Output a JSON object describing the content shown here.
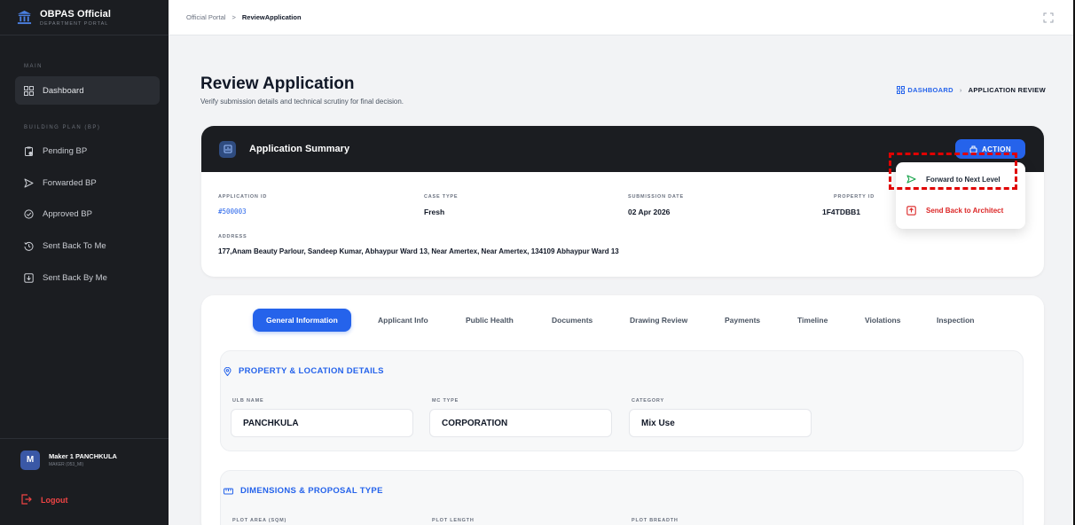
{
  "app": {
    "title": "OBPAS Official",
    "subtitle": "DEPARTMENT PORTAL"
  },
  "sidebar": {
    "section_main": "MAIN",
    "section_bp": "BUILDING PLAN (BP)",
    "items": [
      {
        "label": "Dashboard",
        "icon": "grid-icon"
      },
      {
        "label": "Pending BP",
        "icon": "clipboard-icon"
      },
      {
        "label": "Forwarded BP",
        "icon": "send-icon"
      },
      {
        "label": "Approved BP",
        "icon": "check-circle-icon"
      },
      {
        "label": "Sent Back To Me",
        "icon": "history-icon"
      },
      {
        "label": "Sent Back By Me",
        "icon": "return-box-icon"
      }
    ],
    "user": {
      "initial": "M",
      "name": "Maker 1 PANCHKULA",
      "role": "MAKER (053_MI)"
    },
    "logout": "Logout"
  },
  "topbar": {
    "crumb_root": "Official Portal",
    "crumb_sep": ">",
    "crumb_current": "ReviewApplication"
  },
  "page": {
    "title": "Review Application",
    "subtitle": "Verify submission details and technical scrutiny for final decision.",
    "crumb_dashboard": "DASHBOARD",
    "crumb_sep": "›",
    "crumb_current": "APPLICATION REVIEW"
  },
  "summary": {
    "title": "Application Summary",
    "action_label": "ACTION",
    "fields": {
      "app_id_label": "APPLICATION ID",
      "app_id_value": "#500003",
      "case_type_label": "CASE TYPE",
      "case_type_value": "Fresh",
      "submission_label": "SUBMISSION DATE",
      "submission_value": "02 Apr 2026",
      "property_label": "PROPERTY ID",
      "property_value": "1F4TDBB1",
      "address_label": "ADDRESS",
      "address_value": "177,Anam Beauty Parlour, Sandeep Kumar, Abhaypur Ward 13, Near Amertex, Near Amertex, 134109 Abhaypur Ward 13"
    }
  },
  "action_menu": {
    "forward": "Forward to Next Level",
    "send_back": "Send Back to Architect"
  },
  "tabs": [
    "General Information",
    "Applicant Info",
    "Public Health",
    "Documents",
    "Drawing Review",
    "Payments",
    "Timeline",
    "Violations",
    "Inspection"
  ],
  "property_section": {
    "title": "PROPERTY & LOCATION DETAILS",
    "ulb_label": "ULB NAME",
    "ulb_value": "PANCHKULA",
    "mc_label": "MC TYPE",
    "mc_value": "CORPORATION",
    "category_label": "CATEGORY",
    "category_value": "Mix Use"
  },
  "dimensions_section": {
    "title": "DIMENSIONS & PROPOSAL TYPE",
    "plot_area_label": "PLOT AREA (SQM)",
    "plot_length_label": "PLOT LENGTH",
    "plot_breadth_label": "PLOT BREADTH"
  },
  "colors": {
    "accent": "#2563eb",
    "sidebar_bg": "#1b1d21",
    "danger": "#dc2626",
    "highlight": "#e00000"
  }
}
